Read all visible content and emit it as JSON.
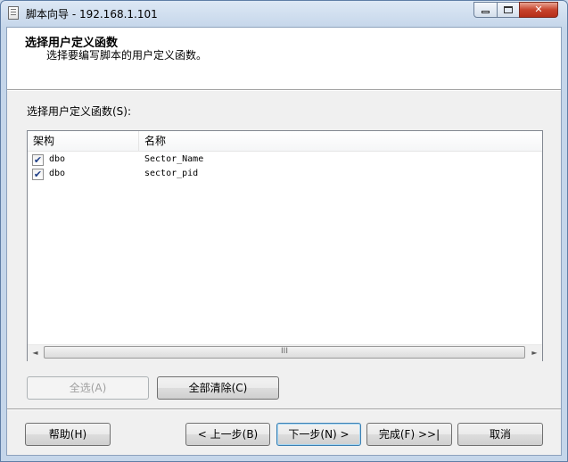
{
  "window": {
    "title": "脚本向导 - 192.168.1.101"
  },
  "header": {
    "title": "选择用户定义函数",
    "subtitle": "选择要编写脚本的用户定义函数。"
  },
  "list": {
    "label": "选择用户定义函数(S):",
    "columns": [
      "架构",
      "名称"
    ],
    "rows": [
      {
        "checked": true,
        "schema": "dbo",
        "name": "Sector_Name"
      },
      {
        "checked": true,
        "schema": "dbo",
        "name": "sector_pid"
      }
    ],
    "scroll_thumb": "III"
  },
  "buttons": {
    "select_all": "全选(A)",
    "clear_all": "全部清除(C)",
    "help": "帮助(H)",
    "prev": "< 上一步(B)",
    "next": "下一步(N) >",
    "finish": "完成(F) >>|",
    "cancel": "取消"
  },
  "icons": {
    "check": "✔",
    "scroll_left": "◄",
    "scroll_right": "►"
  }
}
